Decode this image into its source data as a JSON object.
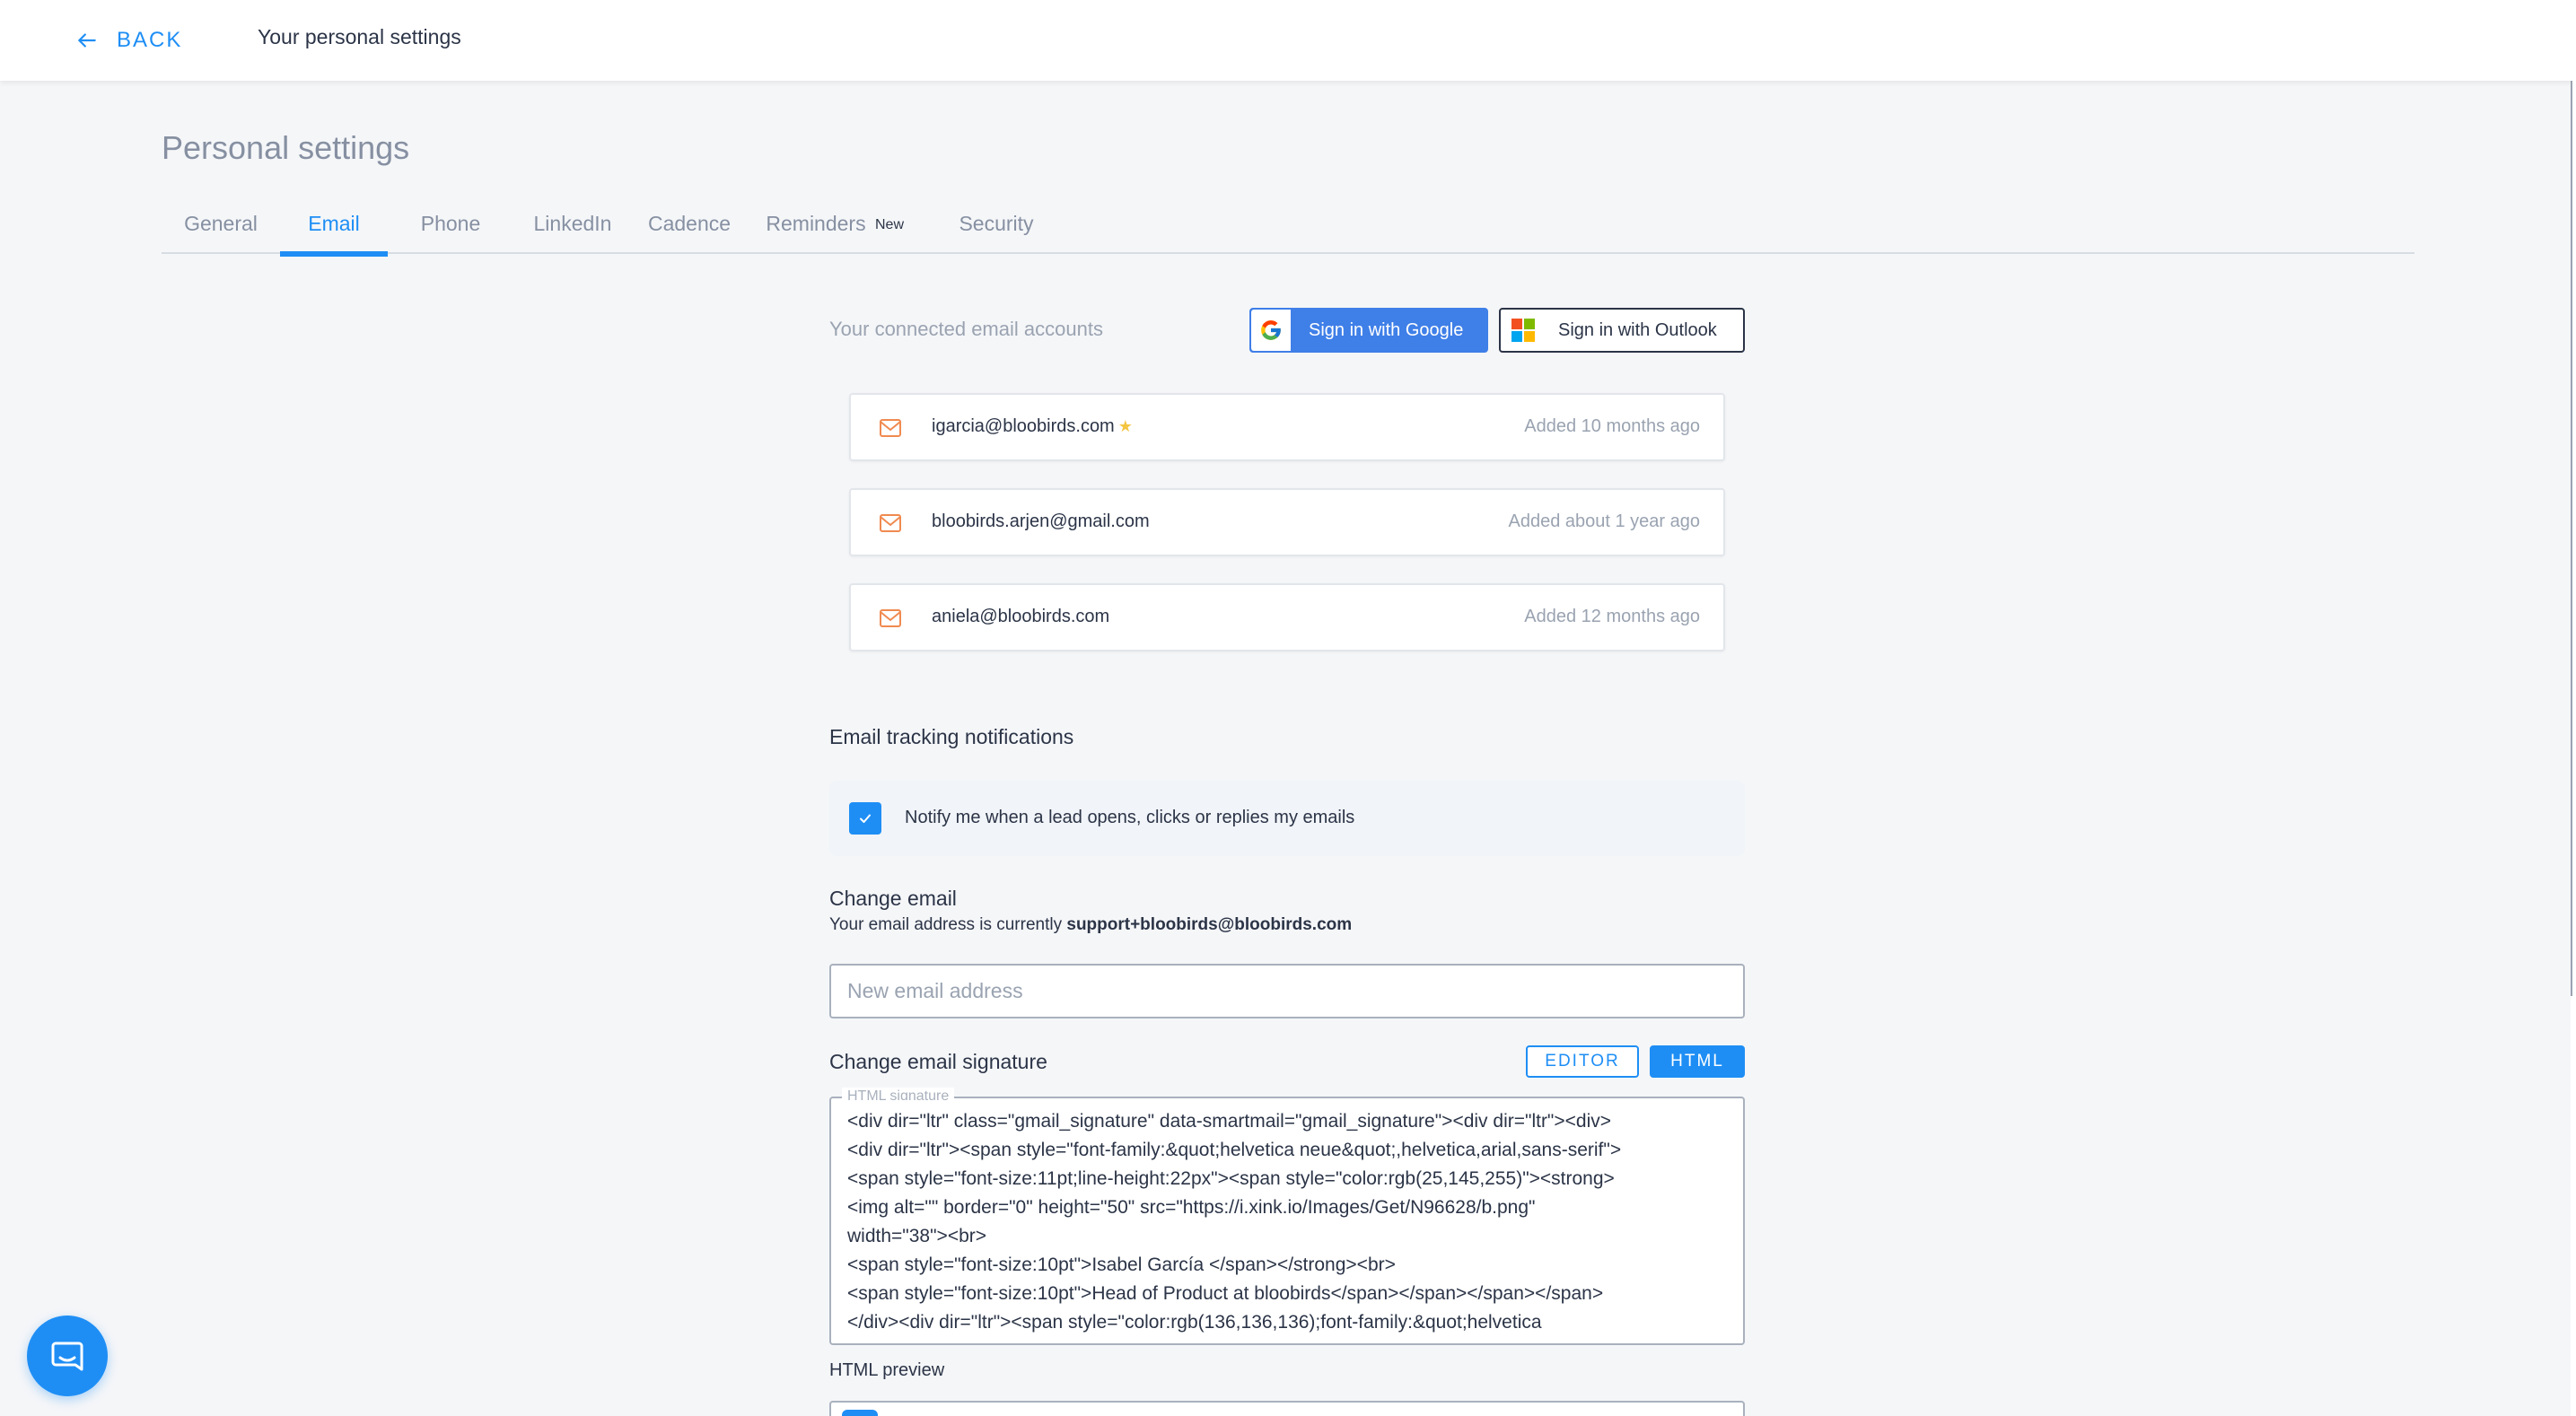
{
  "topbar": {
    "back_label": "BACK",
    "title": "Your personal settings"
  },
  "page": {
    "title": "Personal settings"
  },
  "tabs": [
    {
      "label": "General",
      "active": false
    },
    {
      "label": "Email",
      "active": true
    },
    {
      "label": "Phone",
      "active": false
    },
    {
      "label": "LinkedIn",
      "active": false
    },
    {
      "label": "Cadence",
      "active": false
    },
    {
      "label": "Reminders",
      "active": false
    },
    {
      "label": "Security",
      "active": false
    }
  ],
  "reminders_badge": "New",
  "connected": {
    "label": "Your connected email accounts",
    "google_button": "Sign in with Google",
    "outlook_button": "Sign in with Outlook",
    "accounts": [
      {
        "email": "igarcia@bloobirds.com",
        "added": "Added 10 months ago",
        "default": true
      },
      {
        "email": "bloobirds.arjen@gmail.com",
        "added": "Added about 1 year ago",
        "default": false
      },
      {
        "email": "aniela@bloobirds.com",
        "added": "Added 12 months ago",
        "default": false
      }
    ]
  },
  "tracking": {
    "heading": "Email tracking notifications",
    "checkbox_label": "Notify me when a lead opens, clicks or replies my emails",
    "checked": true
  },
  "change_email": {
    "heading": "Change email",
    "current_prefix": "Your email address is currently",
    "current_email": "support+bloobirds@bloobirds.com",
    "input_placeholder": "New email address",
    "input_value": ""
  },
  "signature": {
    "heading": "Change email signature",
    "editor_button": "EDITOR",
    "html_button": "HTML",
    "field_label": "HTML signature",
    "html_value": "<div dir=\"ltr\" class=\"gmail_signature\" data-smartmail=\"gmail_signature\"><div dir=\"ltr\"><div>\n<div dir=\"ltr\"><span style=\"font-family:&quot;helvetica neue&quot;,helvetica,arial,sans-serif\">\n<span style=\"font-size:11pt;line-height:22px\"><span style=\"color:rgb(25,145,255)\"><strong>\n<img alt=\"\" border=\"0\" height=\"50\" src=\"https://i.xink.io/Images/Get/N96628/b.png\"\nwidth=\"38\"><br>\n<span style=\"font-size:10pt\">Isabel García </span></strong><br>\n<span style=\"font-size:10pt\">Head of Product at bloobirds</span></span></span></span>\n</div><div dir=\"ltr\"><span style=\"color:rgb(136,136,136);font-family:&quot;helvetica",
    "preview_label": "HTML preview"
  },
  "colors": {
    "accent": "#1e8ef5",
    "mail_icon": "#f08a50",
    "star": "#f4c542"
  },
  "icons": {
    "back": "arrow-left-icon",
    "account": "mail-icon",
    "default_account": "star-icon",
    "google": "google-logo-icon",
    "outlook": "microsoft-logo-icon",
    "checkbox": "check-icon",
    "chat": "chat-bubble-icon"
  }
}
